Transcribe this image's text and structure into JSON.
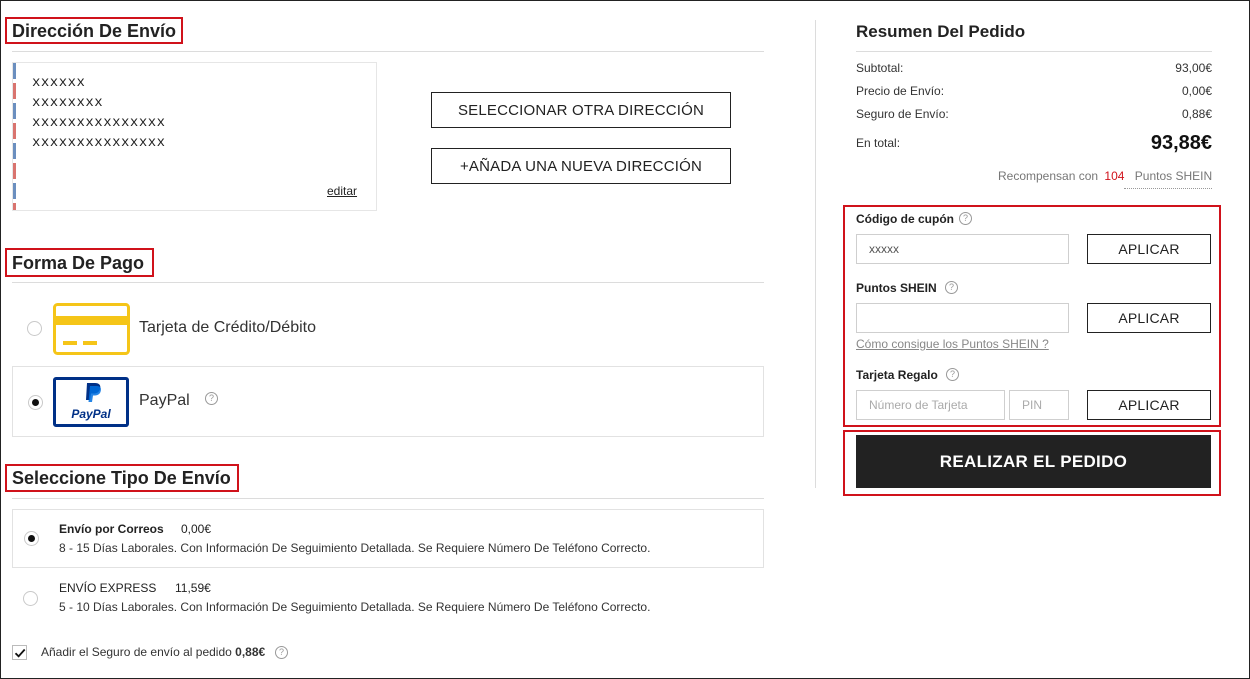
{
  "address": {
    "title": "Dirección De Envío",
    "lines": [
      "xxxxxx",
      "xxxxxxxx",
      "xxxxxxxxxxxxxxx",
      "xxxxxxxxxxxxxxx"
    ],
    "edit_label": "editar",
    "select_other_label": "SELECCIONAR OTRA DIRECCIÓN",
    "add_new_label": "+AÑADA UNA NUEVA DIRECCIÓN"
  },
  "payment": {
    "title": "Forma De Pago",
    "methods": [
      {
        "label": "Tarjeta de Crédito/Débito",
        "selected": false,
        "icon": "credit-card-icon"
      },
      {
        "label": "PayPal",
        "selected": true,
        "icon": "paypal-logo",
        "logo_text": "PayPal"
      }
    ],
    "help_glyph": "?"
  },
  "shipping": {
    "title": "Seleccione Tipo De Envío",
    "options": [
      {
        "name": "Envío por Correos",
        "price": "0,00€",
        "desc": "8 - 15 Días Laborales. Con Información De Seguimiento Detallada. Se Requiere Número De Teléfono Correcto.",
        "selected": true
      },
      {
        "name": "ENVÍO EXPRESS",
        "price": "11,59€",
        "desc": "5 - 10 Días Laborales. Con Información De Seguimiento Detallada. Se Requiere Número De Teléfono Correcto.",
        "selected": false
      }
    ],
    "insurance_label": "Añadir el Seguro de envío al pedido",
    "insurance_price": "0,88€",
    "insurance_checked": true
  },
  "summary": {
    "title": "Resumen Del Pedido",
    "subtotal_label": "Subtotal:",
    "subtotal_value": "93,00€",
    "shipping_label": "Precio de Envío:",
    "shipping_value": "0,00€",
    "insurance_label": "Seguro de Envío:",
    "insurance_value": "0,88€",
    "total_label": "En total:",
    "total_value": "93,88€",
    "rewards_prefix": "Recompensan con",
    "rewards_points": "104",
    "rewards_suffix": "Puntos SHEIN"
  },
  "coupon": {
    "label": "Código de cupón",
    "value": "xxxxx",
    "apply_label": "APLICAR"
  },
  "points": {
    "label": "Puntos SHEIN",
    "value": "",
    "apply_label": "APLICAR",
    "link_label": "Cómo consigue los Puntos SHEIN ?"
  },
  "giftcard": {
    "label": "Tarjeta Regalo",
    "number_placeholder": "Número de Tarjeta",
    "pin_placeholder": "PIN",
    "apply_label": "APLICAR"
  },
  "place_order_label": "REALIZAR EL PEDIDO",
  "colors": {
    "accent_red": "#d0121b",
    "dark_button": "#222222",
    "paypal_blue": "#003087",
    "card_yellow": "#f5c518"
  }
}
